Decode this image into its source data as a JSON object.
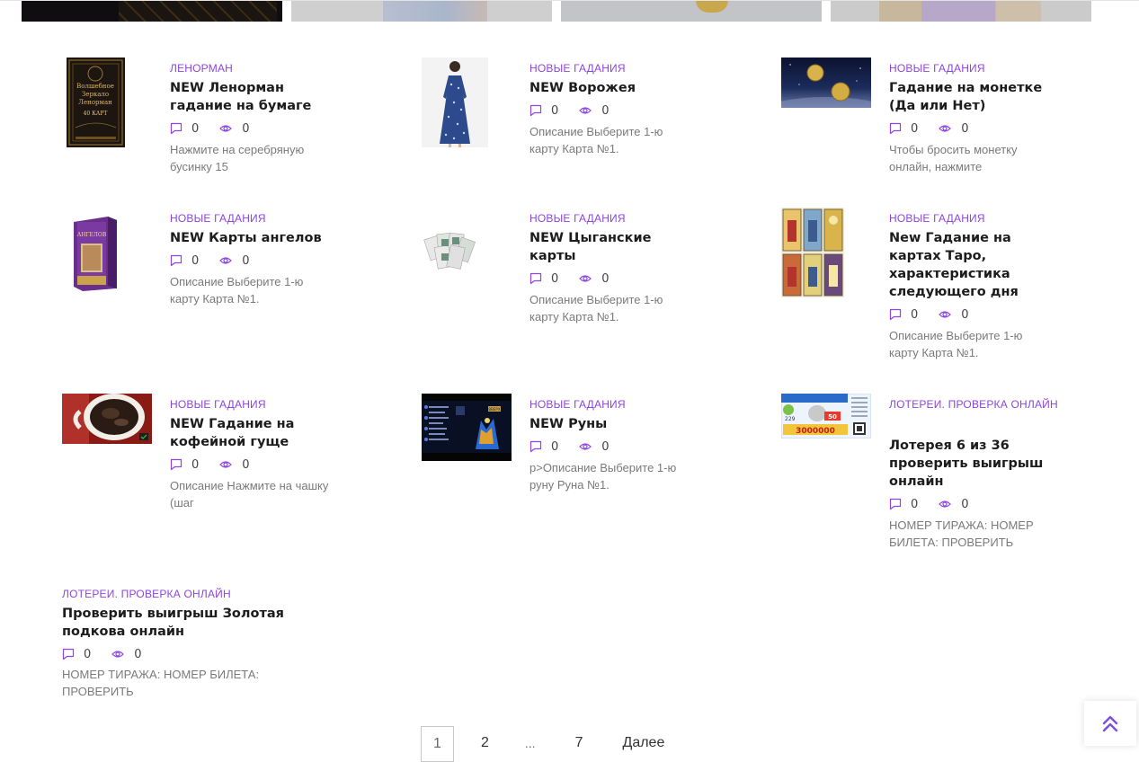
{
  "banners": [
    "banner-1",
    "banner-2",
    "banner-3",
    "banner-4"
  ],
  "posts": [
    {
      "category": "ЛЕНОРМАН",
      "title": "NEW Ленорман гадание на бумаге",
      "comments": "0",
      "views": "0",
      "excerpt": "Нажмите на серебряную бусинку 15"
    },
    {
      "category": "НОВЫЕ ГАДАНИЯ",
      "title": "NEW Ворожея",
      "comments": "0",
      "views": "0",
      "excerpt": "Описание Выберите 1-ю карту Карта №1."
    },
    {
      "category": "НОВЫЕ ГАДАНИЯ",
      "title": "Гадание на монетке (Да или Нет)",
      "comments": "0",
      "views": "0",
      "excerpt": "Чтобы бросить монетку онлайн, нажмите"
    },
    {
      "category": "НОВЫЕ ГАДАНИЯ",
      "title": "NEW Карты ангелов",
      "comments": "0",
      "views": "0",
      "excerpt": "Описание Выберите 1-ю карту Карта №1."
    },
    {
      "category": "НОВЫЕ ГАДАНИЯ",
      "title": "NEW Цыганские карты",
      "comments": "0",
      "views": "0",
      "excerpt": "Описание Выберите 1-ю карту Карта №1."
    },
    {
      "category": "НОВЫЕ ГАДАНИЯ",
      "title": "New Гадание на картах Таро, характеристика следующего дня",
      "comments": "0",
      "views": "0",
      "excerpt": "Описание Выберите 1-ю карту Карта №1."
    },
    {
      "category": "НОВЫЕ ГАДАНИЯ",
      "title": "NEW Гадание на кофейной гуще",
      "comments": "0",
      "views": "0",
      "excerpt": "Описание Нажмите на чашку (шаг"
    },
    {
      "category": "НОВЫЕ ГАДАНИЯ",
      "title": "NEW Руны",
      "comments": "0",
      "views": "0",
      "excerpt": "p>Описание Выберите 1-ю руну Руна №1."
    },
    {
      "category": "ЛОТЕРЕИ. ПРОВЕРКА ОНЛАЙН",
      "title": "Лотерея 6 из 36 проверить выигрыш онлайн",
      "comments": "0",
      "views": "0",
      "excerpt": "НОМЕР ТИРАЖА: НОМЕР БИЛЕТА: ПРОВЕРИТЬ"
    },
    {
      "category": "ЛОТЕРЕИ. ПРОВЕРКА ОНЛАЙН",
      "title": "Проверить выигрыш Золотая подкова онлайн",
      "comments": "0",
      "views": "0",
      "excerpt": "НОМЕР ТИРАЖА: НОМЕР БИЛЕТА: ПРОВЕРИТЬ"
    }
  ],
  "thumb_texts": {
    "lenorman": [
      "Волшебное",
      "Зеркало",
      "Ленорман",
      "40 КАРТ"
    ],
    "angels": [
      "АНГЕЛОВ"
    ],
    "lottery": [
      "229",
      "50",
      "3000000"
    ],
    "runes": [
      "ВВЕРХ"
    ]
  },
  "pagination": {
    "current": "1",
    "p2": "2",
    "dots": "...",
    "p7": "7",
    "next": "Далее"
  },
  "icons": {
    "comment": "comment-icon",
    "views": "eye-icon",
    "to_top": "double-chevron-up-icon"
  },
  "colors": {
    "accent": "#8e44e0",
    "title": "#1c1c1c",
    "excerpt": "#7a7a7a"
  }
}
